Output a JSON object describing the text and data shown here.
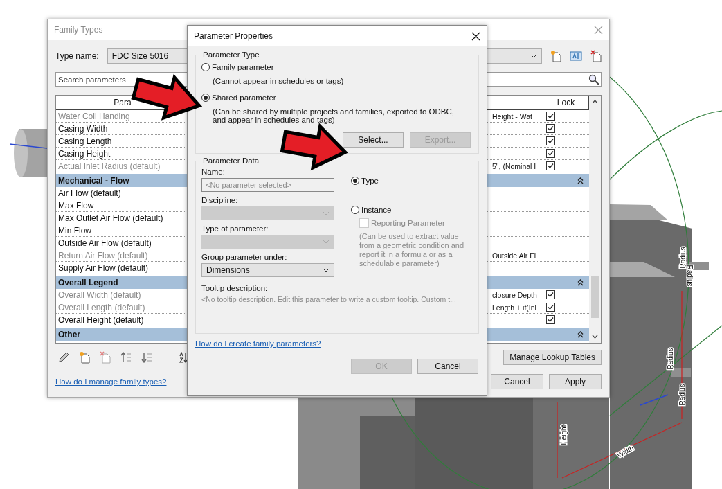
{
  "model_view": {
    "labels": [
      {
        "text": "Radius"
      },
      {
        "text": "Radius"
      },
      {
        "text": "Radius"
      },
      {
        "text": "Radius"
      },
      {
        "text": "Height"
      },
      {
        "text": "Width"
      }
    ]
  },
  "family_types": {
    "title": "Family Types",
    "type_name_label": "Type name:",
    "type_name_value": "FDC Size 5016",
    "search_placeholder": "Search parameters",
    "columns": [
      "Para",
      "Lock"
    ],
    "rows": [
      {
        "kind": "param",
        "name": "Water Coil Handing",
        "disabled": true,
        "value": "Height - Wat",
        "locked": true
      },
      {
        "kind": "param",
        "name": "Casing Width",
        "disabled": false,
        "locked": true
      },
      {
        "kind": "param",
        "name": "Casing Length",
        "disabled": false,
        "locked": true
      },
      {
        "kind": "param",
        "name": "Casing Height",
        "disabled": false,
        "locked": true
      },
      {
        "kind": "param",
        "name": "Actual Inlet Radius (default)",
        "disabled": true,
        "value": "5\", (Nominal I",
        "locked": true
      },
      {
        "kind": "group",
        "name": "Mechanical - Flow"
      },
      {
        "kind": "param",
        "name": "Air Flow (default)",
        "disabled": false,
        "locked": false
      },
      {
        "kind": "param",
        "name": "Max Flow",
        "disabled": false,
        "locked": false
      },
      {
        "kind": "param",
        "name": "Max Outlet Air Flow (default)",
        "disabled": false,
        "locked": false
      },
      {
        "kind": "param",
        "name": "Min Flow",
        "disabled": false,
        "locked": false
      },
      {
        "kind": "param",
        "name": "Outside Air Flow (default)",
        "disabled": false,
        "locked": false
      },
      {
        "kind": "param",
        "name": "Return Air Flow (default)",
        "disabled": true,
        "value": "Outside Air Fl",
        "locked": false
      },
      {
        "kind": "param",
        "name": "Supply Air Flow (default)",
        "disabled": false,
        "locked": false
      },
      {
        "kind": "group",
        "name": "Overall Legend"
      },
      {
        "kind": "param",
        "name": "Overall Width (default)",
        "disabled": true,
        "value": "closure Depth",
        "locked": true
      },
      {
        "kind": "param",
        "name": "Overall Length (default)",
        "disabled": true,
        "value": "Length + if(Inl",
        "locked": true
      },
      {
        "kind": "param",
        "name": "Overall Height (default)",
        "disabled": false,
        "locked": true
      },
      {
        "kind": "group",
        "name": "Other"
      }
    ],
    "manage_button": "Manage Lookup Tables",
    "help_link": "How do I manage family types?",
    "buttons": [
      "Cancel",
      "Apply"
    ]
  },
  "dialog": {
    "title": "Parameter Properties",
    "parameter_type": {
      "legend": "Parameter Type",
      "options": [
        {
          "label": "Family parameter",
          "note": "(Cannot appear in schedules or tags)",
          "selected": false
        },
        {
          "label": "Shared parameter",
          "note": "(Can be shared by multiple projects and families, exported to ODBC, and appear in schedules and tags)",
          "selected": true
        }
      ],
      "buttons": [
        {
          "label": "Select...",
          "disabled": false
        },
        {
          "label": "Export...",
          "disabled": true
        }
      ]
    },
    "parameter_data": {
      "legend": "Parameter Data",
      "fields": [
        {
          "kind": "text",
          "label": "Name:",
          "placeholder": "<No parameter selected>"
        },
        {
          "kind": "combo",
          "label": "Discipline:",
          "disabled": true
        },
        {
          "kind": "combo",
          "label": "Type of parameter:",
          "disabled": true
        },
        {
          "kind": "combo",
          "label": "Group parameter under:",
          "disabled": false,
          "value": "Dimensions"
        }
      ],
      "scope": [
        {
          "label": "Type",
          "selected": true
        },
        {
          "label": "Instance",
          "selected": false
        }
      ],
      "reporting": {
        "label": "Reporting Parameter",
        "checked": false,
        "disabled": true,
        "note": "(Can be used to extract value from a geometric condition and report it in a formula or as a schedulable parameter)"
      },
      "tooltip_label": "Tooltip description:",
      "tooltip_text": "<No tooltip description. Edit this parameter to write a custom tooltip. Custom t..."
    },
    "help_link": "How do I create family parameters?",
    "buttons": [
      {
        "label": "OK",
        "disabled": true
      },
      {
        "label": "Cancel",
        "disabled": false
      }
    ]
  }
}
